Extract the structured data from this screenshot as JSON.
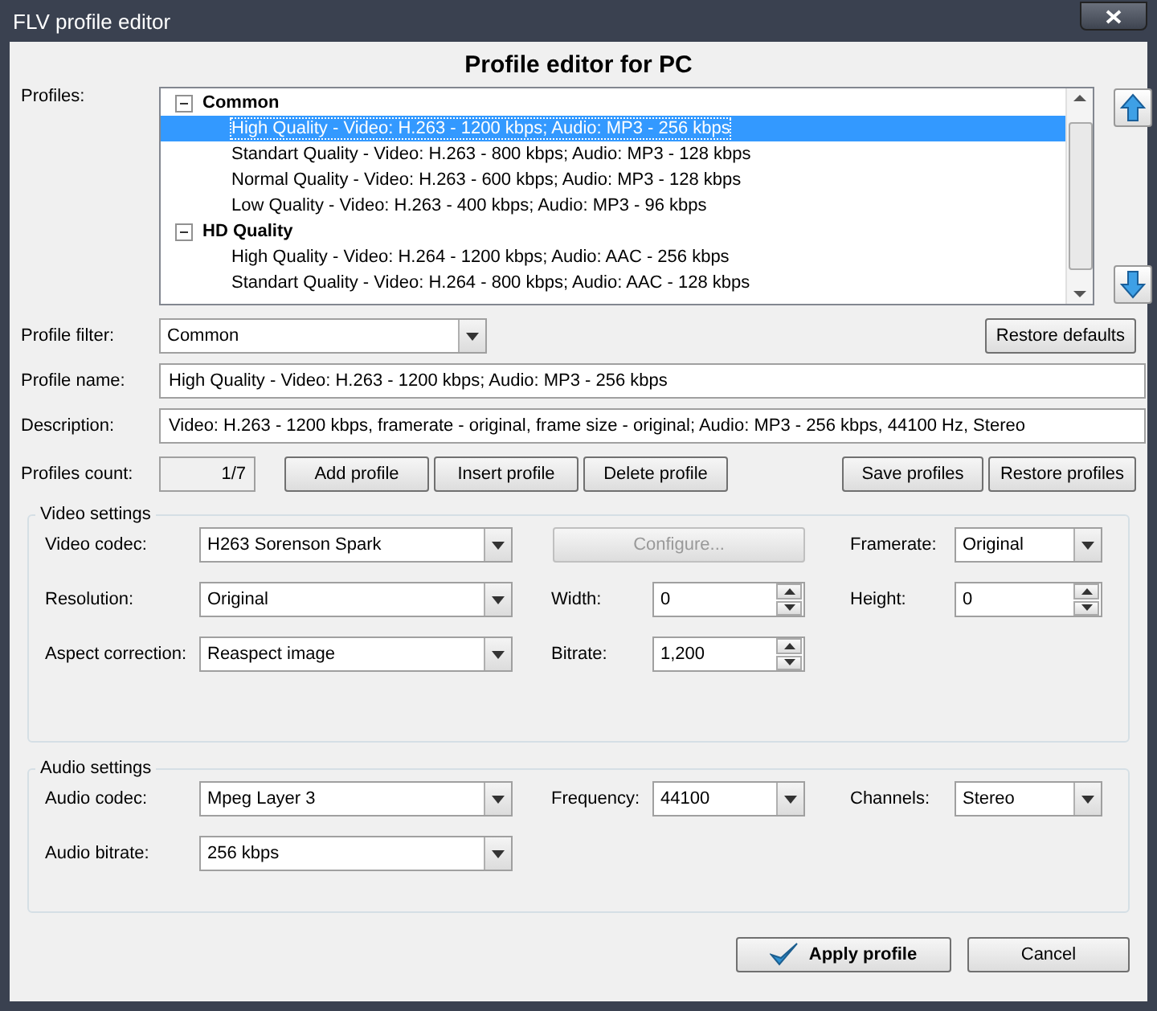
{
  "window": {
    "title": "FLV profile editor"
  },
  "heading": "Profile editor for PC",
  "profiles": {
    "label": "Profiles:",
    "groups": [
      {
        "name": "Common",
        "expanded": true,
        "items": [
          {
            "label": "High Quality - Video: H.263 - 1200 kbps; Audio: MP3 - 256 kbps",
            "selected": true
          },
          {
            "label": "Standart Quality - Video: H.263 - 800 kbps; Audio: MP3 - 128 kbps",
            "selected": false
          },
          {
            "label": "Normal Quality - Video: H.263 - 600 kbps; Audio: MP3 - 128 kbps",
            "selected": false
          },
          {
            "label": "Low Quality - Video: H.263 - 400 kbps; Audio: MP3 - 96 kbps",
            "selected": false
          }
        ]
      },
      {
        "name": "HD Quality",
        "expanded": true,
        "items": [
          {
            "label": "High Quality - Video: H.264 - 1200 kbps; Audio: AAC - 256 kbps",
            "selected": false
          },
          {
            "label": "Standart Quality - Video: H.264 - 800 kbps; Audio: AAC - 128 kbps",
            "selected": false
          }
        ]
      }
    ]
  },
  "filter": {
    "label": "Profile filter:",
    "value": "Common",
    "button": "Restore defaults"
  },
  "profile_name": {
    "label": "Profile name:",
    "value": "High Quality - Video: H.263 - 1200 kbps; Audio: MP3 - 256 kbps"
  },
  "description": {
    "label": "Description:",
    "value": "Video: H.263 - 1200 kbps, framerate - original, frame size - original; Audio: MP3 - 256 kbps, 44100 Hz, Stereo"
  },
  "count": {
    "label": "Profiles count:",
    "value": "1/7"
  },
  "profile_buttons": [
    "Add profile",
    "Insert profile",
    "Delete profile"
  ],
  "file_buttons": [
    "Save profiles",
    "Restore profiles"
  ],
  "video_settings": {
    "title": "Video settings",
    "rows": [
      [
        {
          "kind": "combo",
          "label": "Video codec:",
          "value": "H263 Sorenson Spark"
        },
        {
          "kind": "button",
          "label": "Configure...",
          "disabled": true
        },
        {
          "kind": "combo",
          "label": "Framerate:",
          "value": "Original"
        }
      ],
      [
        {
          "kind": "combo",
          "label": "Resolution:",
          "value": "Original"
        },
        {
          "kind": "spin",
          "label": "Width:",
          "value": "0"
        },
        {
          "kind": "spin",
          "label": "Height:",
          "value": "0"
        }
      ],
      [
        {
          "kind": "combo",
          "label": "Aspect correction:",
          "value": "Reaspect image"
        },
        {
          "kind": "spin",
          "label": "Bitrate:",
          "value": "1,200"
        }
      ]
    ]
  },
  "audio_settings": {
    "title": "Audio settings",
    "rows": [
      [
        {
          "kind": "combo",
          "label": "Audio codec:",
          "value": "Mpeg Layer 3"
        },
        {
          "kind": "combo",
          "label": "Frequency:",
          "value": "44100"
        },
        {
          "kind": "combo",
          "label": "Channels:",
          "value": "Stereo"
        }
      ],
      [
        {
          "kind": "combo",
          "label": "Audio bitrate:",
          "value": "256 kbps"
        }
      ]
    ]
  },
  "dialog_buttons": [
    {
      "label": "Apply profile",
      "kind": "primary"
    },
    {
      "label": "Cancel",
      "kind": "normal"
    }
  ]
}
